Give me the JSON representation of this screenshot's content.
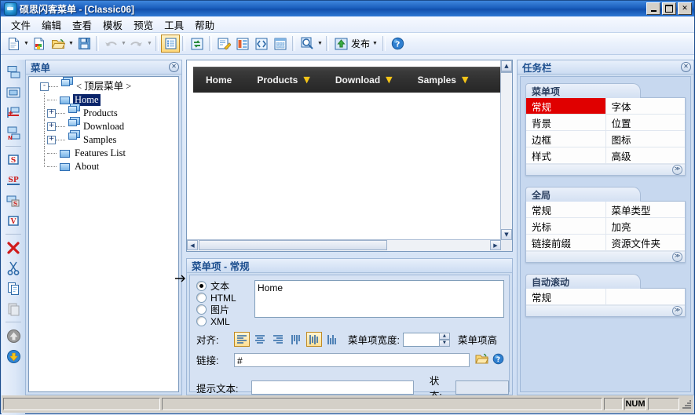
{
  "window": {
    "title": "硕思闪客菜单 - [Classic06]",
    "logo_icon": "app-logo-icon",
    "buttons": {
      "minimize": "_",
      "maximize": "□",
      "close": "✕"
    }
  },
  "menubar": {
    "items": [
      {
        "label": "文件"
      },
      {
        "label": "编辑"
      },
      {
        "label": "查看"
      },
      {
        "label": "模板"
      },
      {
        "label": "预览"
      },
      {
        "label": "工具"
      },
      {
        "label": "帮助"
      }
    ]
  },
  "toolbar": {
    "publish_label": "发布",
    "buttons": [
      {
        "name": "new-document-icon",
        "dropdown": true,
        "enabled": true
      },
      {
        "name": "import-document-icon",
        "dropdown": false,
        "enabled": true
      },
      {
        "name": "open-folder-icon",
        "dropdown": true,
        "enabled": true
      },
      {
        "name": "save-icon",
        "dropdown": false,
        "enabled": true
      },
      {
        "name": "undo-icon",
        "dropdown": true,
        "enabled": false
      },
      {
        "name": "redo-icon",
        "dropdown": true,
        "enabled": false
      },
      {
        "name": "menu-list-icon",
        "dropdown": false,
        "enabled": true,
        "active": true
      },
      {
        "name": "refresh-icon",
        "dropdown": false,
        "enabled": true
      },
      {
        "name": "edit-properties-icon",
        "dropdown": false,
        "enabled": true
      },
      {
        "name": "tree-layout-icon",
        "dropdown": false,
        "enabled": true
      },
      {
        "name": "source-code-icon",
        "dropdown": false,
        "enabled": true
      },
      {
        "name": "preview-window-icon",
        "dropdown": false,
        "enabled": true
      },
      {
        "name": "zoom-preview-icon",
        "dropdown": true,
        "enabled": true
      },
      {
        "name": "publish-icon",
        "dropdown": true,
        "enabled": true
      },
      {
        "name": "help-icon",
        "dropdown": false,
        "enabled": true
      }
    ]
  },
  "vertical_toolbar": {
    "buttons": [
      {
        "name": "add-menu-icon"
      },
      {
        "name": "add-item-icon"
      },
      {
        "name": "insert-item-icon"
      },
      {
        "name": "add-submenu-icon"
      },
      {
        "name": "separator-s-icon"
      },
      {
        "name": "special-sp-icon"
      },
      {
        "name": "sub-s-icon"
      },
      {
        "name": "view-v-icon"
      },
      {
        "name": "delete-icon"
      },
      {
        "name": "cut-icon"
      },
      {
        "name": "copy-icon"
      },
      {
        "name": "paste-icon"
      },
      {
        "name": "move-up-icon"
      },
      {
        "name": "move-down-icon"
      }
    ]
  },
  "tree_panel": {
    "title": "菜单",
    "close_icon": "✕",
    "root": {
      "label": "< 顶层菜单 >",
      "expander": "-",
      "icon": "menu-group-icon"
    },
    "items": [
      {
        "label": "Home",
        "expander": "",
        "icon": "menu-item-icon",
        "selected": true
      },
      {
        "label": "Products",
        "expander": "+",
        "icon": "menu-group-icon",
        "selected": false
      },
      {
        "label": "Download",
        "expander": "+",
        "icon": "menu-group-icon",
        "selected": false
      },
      {
        "label": "Samples",
        "expander": "+",
        "icon": "menu-group-icon",
        "selected": false
      },
      {
        "label": "Features List",
        "expander": "",
        "icon": "menu-item-icon",
        "selected": false
      },
      {
        "label": "About",
        "expander": "",
        "icon": "menu-item-icon",
        "selected": false
      }
    ]
  },
  "preview": {
    "nav_items": [
      {
        "label": "Home",
        "has_arrow": false
      },
      {
        "label": "Products",
        "has_arrow": true
      },
      {
        "label": "Download",
        "has_arrow": true
      },
      {
        "label": "Samples",
        "has_arrow": true
      }
    ],
    "arrow_glyph": "▼",
    "arrow_color": "#f5c518",
    "bar_color": "#2e2e2e"
  },
  "properties_panel": {
    "title": "菜单项 - 常规",
    "close_icon": "✕",
    "content_types": [
      {
        "label": "文本",
        "selected": true
      },
      {
        "label": "HTML",
        "selected": false
      },
      {
        "label": "图片",
        "selected": false
      },
      {
        "label": "XML",
        "selected": false
      }
    ],
    "text_value": "Home",
    "align_label": "对齐:",
    "align_buttons": [
      {
        "name": "align-left-icon",
        "selected": true
      },
      {
        "name": "align-center-icon",
        "selected": false
      },
      {
        "name": "align-right-icon",
        "selected": false
      },
      {
        "name": "valign-top-icon",
        "selected": false
      },
      {
        "name": "valign-middle-icon",
        "selected": true
      },
      {
        "name": "valign-bottom-icon",
        "selected": false
      }
    ],
    "width_label": "菜单项宽度:",
    "width_value": "",
    "height_label": "菜单项高",
    "link_label": "链接:",
    "link_value": "#",
    "browse_icon": "open-folder-icon",
    "link_help_icon": "help-icon",
    "tooltip_label": "提示文本:",
    "tooltip_value": "",
    "status_label": "状态:",
    "status_value": ""
  },
  "task_panel": {
    "title": "任务栏",
    "close_icon": "✕",
    "groups": [
      {
        "title": "菜单项",
        "rows": [
          {
            "left": "常规",
            "right": "字体",
            "left_selected": true
          },
          {
            "left": "背景",
            "right": "位置",
            "left_selected": false
          },
          {
            "left": "边框",
            "right": "图标",
            "left_selected": false
          },
          {
            "left": "样式",
            "right": "高级",
            "left_selected": false
          }
        ],
        "collapse_icon": "collapse-icon"
      },
      {
        "title": "全局",
        "rows": [
          {
            "left": "常规",
            "right": "菜单类型",
            "left_selected": false
          },
          {
            "left": "光标",
            "right": "加亮",
            "left_selected": false
          },
          {
            "left": "链接前缀",
            "right": "资源文件夹",
            "left_selected": false
          }
        ],
        "collapse_icon": "collapse-icon"
      },
      {
        "title": "自动滚动",
        "rows": [
          {
            "left": "常规",
            "right": "",
            "left_selected": false
          }
        ],
        "collapse_icon": "collapse-icon"
      }
    ]
  },
  "statusbar": {
    "message": "",
    "pane2": "",
    "pane3": "",
    "num_indicator": "NUM",
    "pane5": ""
  }
}
